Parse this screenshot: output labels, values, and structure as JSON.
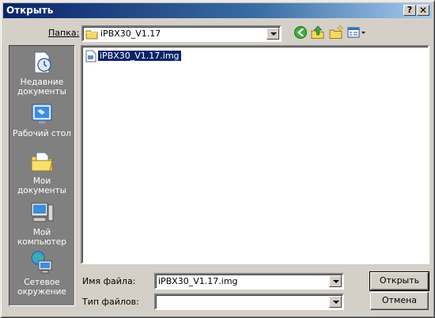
{
  "window": {
    "title": "Открыть",
    "help_glyph": "?",
    "close_glyph": "✕"
  },
  "toolbar": {
    "folder_label": "Папка:",
    "folder_value": "iPBX30_V1.17",
    "icons": [
      "back-icon",
      "up-folder-icon",
      "new-folder-icon",
      "view-menu-icon"
    ]
  },
  "places": [
    {
      "label": "Недавние документы",
      "icon": "recent-documents-icon"
    },
    {
      "label": "Рабочий стол",
      "icon": "desktop-icon"
    },
    {
      "label": "Мои документы",
      "icon": "my-documents-icon"
    },
    {
      "label": "Мой компьютер",
      "icon": "my-computer-icon"
    },
    {
      "label": "Сетевое окружение",
      "icon": "network-icon"
    }
  ],
  "files": [
    {
      "name": "iPBX30_V1.17.img",
      "selected": true
    }
  ],
  "form": {
    "filename_label": "Имя файла:",
    "filename_value": "iPBX30_V1.17.img",
    "filetype_label": "Тип файлов:",
    "filetype_value": ""
  },
  "buttons": {
    "open": "Открыть",
    "cancel": "Отмена"
  },
  "colors": {
    "title_start": "#0a246a",
    "title_end": "#a6caf0",
    "face": "#d4d0c8",
    "selection": "#0a246a"
  }
}
